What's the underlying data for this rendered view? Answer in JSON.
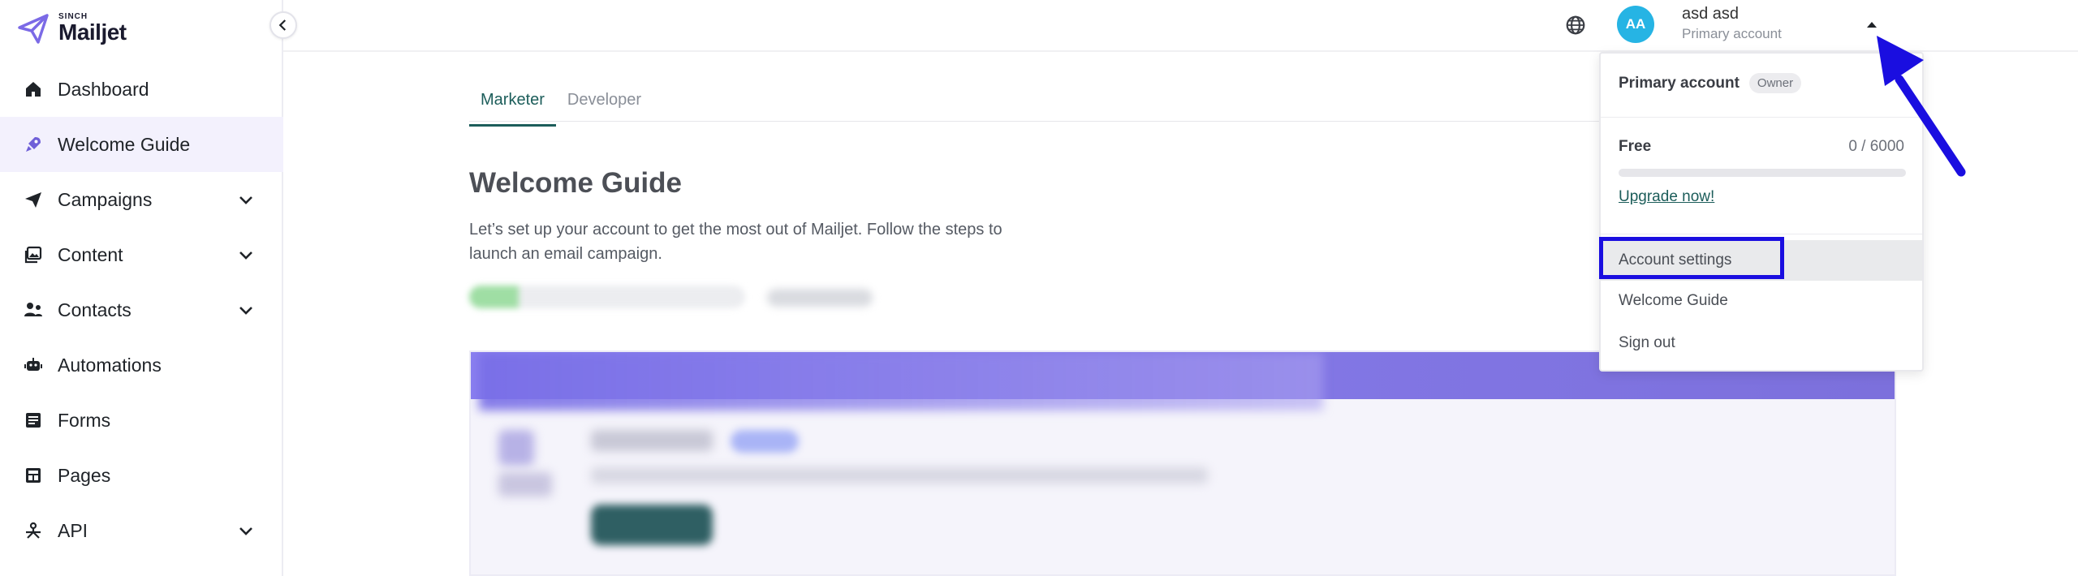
{
  "brand": {
    "logo_sub": "SINCH",
    "logo_main": "Mailjet",
    "accent": "#7b6ae6"
  },
  "sidebar": {
    "items": [
      {
        "label": "Dashboard",
        "icon": "home-icon",
        "expandable": false
      },
      {
        "label": "Welcome Guide",
        "icon": "rocket-icon",
        "expandable": false,
        "active": true
      },
      {
        "label": "Campaigns",
        "icon": "paper-plane-icon",
        "expandable": true
      },
      {
        "label": "Content",
        "icon": "images-icon",
        "expandable": true
      },
      {
        "label": "Contacts",
        "icon": "contacts-icon",
        "expandable": true
      },
      {
        "label": "Automations",
        "icon": "robot-icon",
        "expandable": false
      },
      {
        "label": "Forms",
        "icon": "form-icon",
        "expandable": false
      },
      {
        "label": "Pages",
        "icon": "pages-icon",
        "expandable": false
      },
      {
        "label": "API",
        "icon": "api-icon",
        "expandable": true
      }
    ]
  },
  "header": {
    "avatar_initials": "AA",
    "user_name": "asd asd",
    "user_subtitle": "Primary account"
  },
  "main": {
    "tabs": [
      {
        "label": "Marketer",
        "active": true
      },
      {
        "label": "Developer",
        "active": false
      }
    ],
    "title": "Welcome Guide",
    "description": "Let’s set up your account to get the most out of Mailjet. Follow the steps to launch an email campaign."
  },
  "account_menu": {
    "account_label": "Primary account",
    "owner_badge": "Owner",
    "plan_name": "Free",
    "usage": "0 / 6000",
    "usage_fraction": 0,
    "upgrade_label": "Upgrade now!",
    "items": [
      "Account settings",
      "Welcome Guide",
      "Sign out"
    ]
  },
  "colors": {
    "avatar_bg": "#26b4e4",
    "tab_active": "#1c5d5a",
    "annotation_blue": "#1a0ee0"
  }
}
